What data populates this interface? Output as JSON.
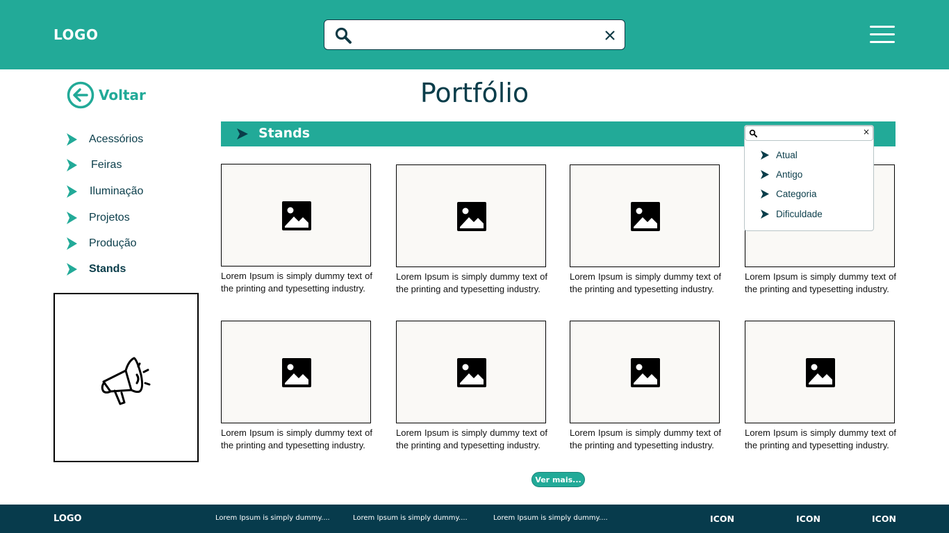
{
  "header": {
    "logo": "LOGO",
    "search": {
      "value": ""
    }
  },
  "back": {
    "label": "Voltar"
  },
  "page_title": "Portfólio",
  "sidebar": {
    "items": [
      {
        "label": "Acessórios"
      },
      {
        "label": "Feiras"
      },
      {
        "label": "Iluminação"
      },
      {
        "label": "Projetos"
      },
      {
        "label": "Produção"
      },
      {
        "label": "Stands",
        "active": true
      }
    ]
  },
  "section": {
    "title": "Stands"
  },
  "filter_dropdown": {
    "search_value": "",
    "clear": "×",
    "options": [
      {
        "label": "Atual"
      },
      {
        "label": "Antigo"
      },
      {
        "label": "Categoria"
      },
      {
        "label": "Dificuldade"
      }
    ]
  },
  "cards": [
    {
      "text": "Lorem Ipsum is simply dummy text of the printing and typesetting industry."
    },
    {
      "text": "Lorem Ipsum is simply dummy text of the printing and typesetting industry."
    },
    {
      "text": "Lorem Ipsum is simply dummy text of the printing and typesetting industry."
    },
    {
      "text": "Lorem Ipsum is simply dummy text of the printing and typesetting industry."
    },
    {
      "text": "Lorem Ipsum is simply dummy text of the printing and typesetting industry."
    },
    {
      "text": "Lorem Ipsum is simply dummy text of the printing and typesetting industry."
    },
    {
      "text": "Lorem Ipsum is simply dummy text of the printing and typesetting industry."
    },
    {
      "text": "Lorem Ipsum is simply dummy text of the printing and typesetting industry."
    }
  ],
  "more_button": {
    "label": "Ver mais..."
  },
  "footer": {
    "logo": "LOGO",
    "links": [
      {
        "label": "Lorem Ipsum is simply dummy...."
      },
      {
        "label": "Lorem Ipsum is simply dummy...."
      },
      {
        "label": "Lorem Ipsum is simply dummy...."
      }
    ],
    "icons": [
      {
        "label": "ICON"
      },
      {
        "label": "ICON"
      },
      {
        "label": "ICON"
      }
    ]
  },
  "colors": {
    "brand": "#22aa98",
    "dark": "#073b4c",
    "text": "#0a3d4a"
  },
  "icons": {
    "search": "search-icon",
    "clear": "close-icon",
    "menu": "hamburger-menu-icon",
    "back": "arrow-left-circle-icon",
    "bullet": "triangle-right-icon",
    "image": "image-placeholder-icon",
    "promo": "megaphone-icon"
  }
}
